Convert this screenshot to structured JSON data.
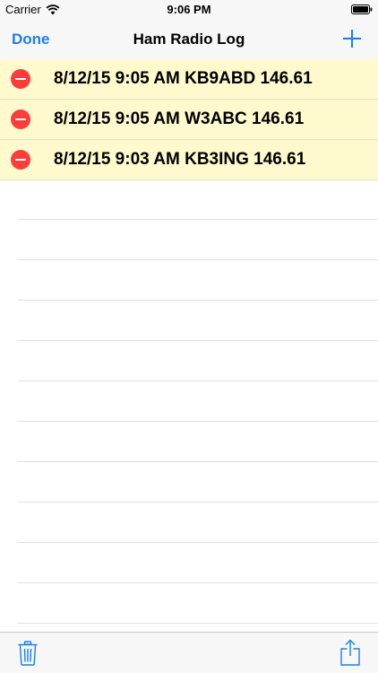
{
  "status_bar": {
    "carrier": "Carrier",
    "time": "9:06 PM"
  },
  "nav": {
    "done_label": "Done",
    "title": "Ham Radio Log",
    "add_icon": "plus-icon"
  },
  "log_entries": [
    {
      "text": "8/12/15 9:05 AM KB9ABD 146.61"
    },
    {
      "text": "8/12/15 9:05 AM W3ABC 146.61"
    },
    {
      "text": "8/12/15 9:03 AM KB3ING 146.61"
    }
  ],
  "toolbar": {
    "trash_icon": "trash-icon",
    "share_icon": "share-icon"
  },
  "colors": {
    "accent": "#1a7ef2",
    "row_background": "#fffacd",
    "delete": "#fc3d39"
  }
}
